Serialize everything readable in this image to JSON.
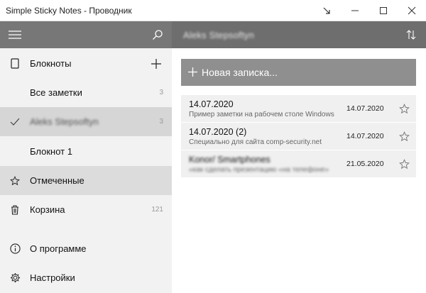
{
  "window": {
    "title": "Simple Sticky Notes - Проводник",
    "buttons": [
      "restore-down",
      "minimize",
      "maximize",
      "close"
    ]
  },
  "header": {
    "menu_icon": "hamburger-icon",
    "search_icon": "search-icon",
    "owner_name": "Aleks Stepsoftyn",
    "sort_icon": "sort-icon"
  },
  "sidebar": {
    "notebooks_label": "Блокноты",
    "add_icon": "plus-icon",
    "all_notes_label": "Все заметки",
    "all_notes_count": "3",
    "owner_label": "Aleks Stepsoftyn",
    "owner_count": "3",
    "notebook1_label": "Блокнот 1",
    "starred_label": "Отмеченные",
    "trash_label": "Корзина",
    "trash_count": "121",
    "about_label": "О программе",
    "settings_label": "Настройки"
  },
  "main": {
    "new_note_label": "Новая записка...",
    "notes": [
      {
        "title": "14.07.2020",
        "subtitle": "Пример заметки на рабочем столе Windows",
        "date": "14.07.2020"
      },
      {
        "title": "14.07.2020 (2)",
        "subtitle": "Специально для сайта comp-security.net",
        "date": "14.07.2020"
      },
      {
        "title": "Konor/ Smartphones",
        "subtitle": "«как сделать презентацию «на телефоне»",
        "date": "21.05.2020"
      }
    ]
  }
}
